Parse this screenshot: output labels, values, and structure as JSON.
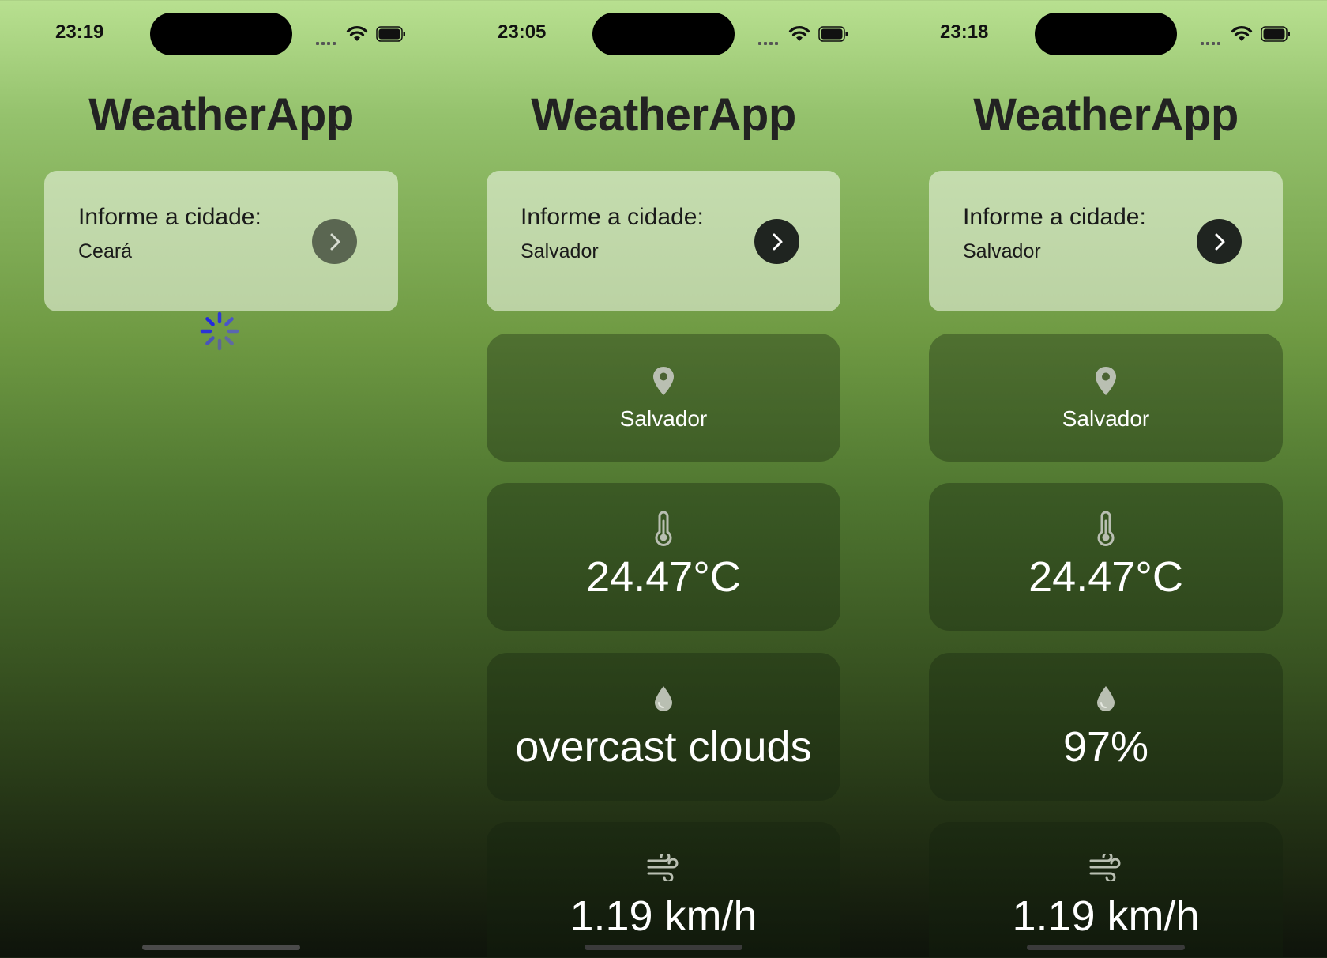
{
  "screens": [
    {
      "status_time": "23:19",
      "app_title": "WeatherApp",
      "search": {
        "label": "Informe a cidade:",
        "value": "Ceará"
      },
      "loading": true
    },
    {
      "status_time": "23:05",
      "app_title": "WeatherApp",
      "search": {
        "label": "Informe a cidade:",
        "value": "Salvador"
      },
      "loading": false,
      "weather": {
        "location": "Salvador",
        "temperature": "24.47°C",
        "detail": "overcast clouds",
        "wind": "1.19 km/h"
      }
    },
    {
      "status_time": "23:18",
      "app_title": "WeatherApp",
      "search": {
        "label": "Informe a cidade:",
        "value": "Salvador"
      },
      "loading": false,
      "weather": {
        "location": "Salvador",
        "temperature": "24.47°C",
        "detail": "97%",
        "wind": "1.19 km/h"
      }
    }
  ],
  "icons": {
    "search_button": "chevron-right-icon",
    "location": "map-pin-icon",
    "temperature": "thermometer-icon",
    "detail": "water-drop-icon",
    "wind": "wind-icon",
    "loading": "spinner-icon"
  },
  "colors": {
    "spinner": "#3a3fd8",
    "button_dark": "#1f2420",
    "title": "#222222",
    "card_text": "#ffffff"
  }
}
